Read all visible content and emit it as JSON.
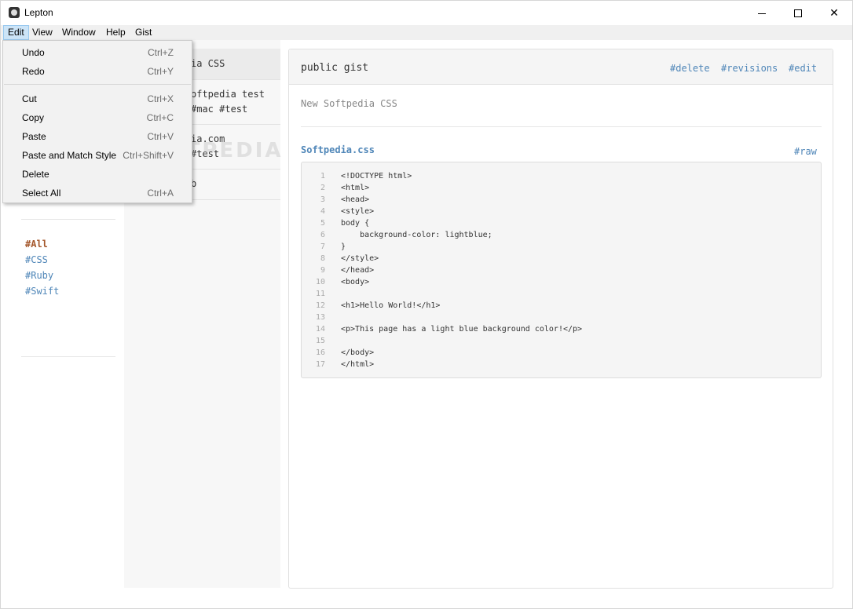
{
  "window": {
    "title": "Lepton"
  },
  "menubar": [
    "Edit",
    "View",
    "Window",
    "Help",
    "Gist"
  ],
  "edit_menu": {
    "items": [
      {
        "label": "Undo",
        "shortcut": "Ctrl+Z"
      },
      {
        "label": "Redo",
        "shortcut": "Ctrl+Y"
      },
      {
        "label": "Cut",
        "shortcut": "Ctrl+X"
      },
      {
        "label": "Copy",
        "shortcut": "Ctrl+C"
      },
      {
        "label": "Paste",
        "shortcut": "Ctrl+V"
      },
      {
        "label": "Paste and Match Style",
        "shortcut": "Ctrl+Shift+V"
      },
      {
        "label": "Delete",
        "shortcut": ""
      },
      {
        "label": "Select All",
        "shortcut": "Ctrl+A"
      }
    ]
  },
  "sidebar": {
    "tags": [
      "#All",
      "#CSS",
      "#Ruby",
      "#Swift"
    ],
    "selected_tag": "#All"
  },
  "gist_list": {
    "items": [
      {
        "lines": [
          "ia CSS"
        ]
      },
      {
        "lines": [
          "oftpedia test",
          "#mac #test"
        ]
      },
      {
        "lines": [
          "ia.com",
          "#test"
        ]
      },
      {
        "lines": [
          "b"
        ]
      }
    ]
  },
  "watermark": "SOFTPEDIA",
  "detail": {
    "title": "public gist",
    "actions": [
      "#delete",
      "#revisions",
      "#edit"
    ],
    "description": "New Softpedia CSS",
    "file_name": "Softpedia.css",
    "raw_label": "#raw",
    "code_lines": [
      "<!DOCTYPE html>",
      "<html>",
      "<head>",
      "<style>",
      "body {",
      "    background-color: lightblue;",
      "}",
      "</style>",
      "</head>",
      "<body>",
      "",
      "<h1>Hello World!</h1>",
      "",
      "<p>This page has a light blue background color!</p>",
      "",
      "</body>",
      "</html>"
    ]
  },
  "colors": {
    "link": "#4f86b8",
    "selected_tag": "#a4562a",
    "menubar_bg": "#f0f0f0"
  }
}
